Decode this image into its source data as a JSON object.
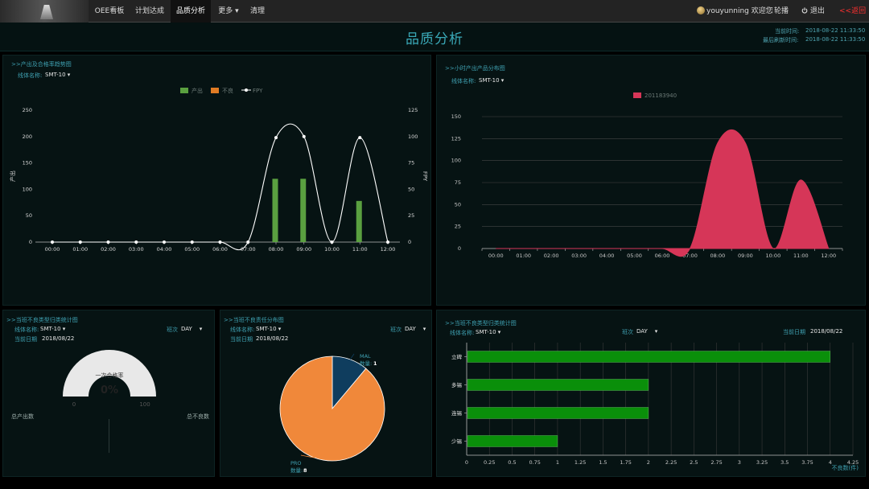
{
  "nav": {
    "tabs": [
      "OEE看板",
      "计划达成",
      "品质分析",
      "更多",
      "清理"
    ],
    "active_tab": "品质分析",
    "more_caret": "▾",
    "user": "youyunning 欢迎您",
    "carousel": "轮播",
    "logout": "退出",
    "back": "<<返回"
  },
  "header": {
    "title": "品质分析",
    "current_time_label": "当前时间:",
    "current_time": "2018-08-22 11:33:50",
    "refresh_time_label": "最后刷新时间:",
    "refresh_time": "2018-08-22 11:33:50"
  },
  "colors": {
    "bar_green": "#5aa040",
    "defect_orange": "#e07b24",
    "pie_orange": "#f0883a",
    "pie_blue": "#0f3d5e",
    "area_red": "#d63658",
    "hbar_green": "#0a8f0a"
  },
  "panel1": {
    "title": ">>产出及合格率趋势图",
    "line_label": "线体名称:",
    "line_value": "SMT-10",
    "caret": "▾",
    "chart_data": {
      "type": "bar+line",
      "categories": [
        "00:00",
        "01:00",
        "02:00",
        "03:00",
        "04:00",
        "05:00",
        "06:00",
        "07:00",
        "08:00",
        "09:00",
        "10:00",
        "11:00",
        "12:00"
      ],
      "series": [
        {
          "name": "产出",
          "type": "bar",
          "axis": "left",
          "values": [
            0,
            0,
            0,
            0,
            0,
            0,
            0,
            0,
            120,
            120,
            0,
            78,
            0
          ]
        },
        {
          "name": "不良",
          "type": "bar",
          "axis": "left",
          "values": [
            0,
            0,
            0,
            0,
            0,
            0,
            0,
            0,
            0,
            0,
            0,
            0,
            0
          ]
        },
        {
          "name": "FPY",
          "type": "line",
          "axis": "right",
          "values": [
            0,
            0,
            0,
            0,
            0,
            0,
            0,
            0,
            99,
            100,
            0,
            99,
            0
          ]
        }
      ],
      "ylabel": "产出",
      "y2label": "FPY",
      "ylim": [
        0,
        250
      ],
      "y2lim": [
        0,
        125
      ],
      "yticks": [
        0,
        50,
        100,
        150,
        200,
        250
      ],
      "y2ticks": [
        0,
        25,
        50,
        75,
        100,
        125
      ],
      "legend": "top-center"
    }
  },
  "panel2": {
    "title": ">>小时产出产品分布图",
    "line_label": "线体名称:",
    "line_value": "SMT-10",
    "caret": "▾",
    "chart_data": {
      "type": "area",
      "categories": [
        "00:00",
        "01:00",
        "02:00",
        "03:00",
        "04:00",
        "05:00",
        "06:00",
        "07:00",
        "08:00",
        "09:00",
        "10:00",
        "11:00",
        "12:00"
      ],
      "series": [
        {
          "name": "201183940",
          "values": [
            0,
            0,
            0,
            0,
            0,
            0,
            0,
            0,
            120,
            120,
            0,
            78,
            0
          ]
        }
      ],
      "ylim": [
        0,
        150
      ],
      "yticks": [
        0,
        25,
        50,
        75,
        100,
        125,
        150
      ],
      "grid": true,
      "legend": "top-center"
    }
  },
  "panel3": {
    "title": ">>当班不良类型归类统计图",
    "line_label": "线体名称:",
    "line_value": "SMT-10",
    "caret": "▾",
    "shift_label": "班次",
    "shift_value": "DAY",
    "date_label": "当前日期",
    "date_value": "2018/08/22",
    "gauge_label": "一次合格率",
    "gauge_value": "0%",
    "gauge_min": "0",
    "gauge_max": "100",
    "gauge_fraction": 0,
    "total_output_label": "总产出数",
    "total_defect_label": "总不良数"
  },
  "panel4": {
    "title": ">>当班不良责任分布图",
    "line_label": "线体名称:",
    "line_value": "SMT-10",
    "caret": "▾",
    "shift_label": "班次",
    "shift_value": "DAY",
    "date_label": "当前日期",
    "date_value": "2018/08/22",
    "chart_data": {
      "type": "pie",
      "slices": [
        {
          "name": "MAL",
          "count_label": "数量:",
          "value": 1
        },
        {
          "name": "PRO",
          "count_label": "数量:",
          "value": 8
        }
      ]
    }
  },
  "panel5": {
    "title": ">>当班不良类型归类统计图",
    "line_label": "线体名称:",
    "line_value": "SMT-10",
    "caret": "▾",
    "shift_label": "班次",
    "shift_value": "DAY",
    "date_label": "当前日期",
    "date_value": "2018/08/22",
    "chart_data": {
      "type": "bar",
      "orientation": "horizontal",
      "categories": [
        "立碑",
        "多锡",
        "连锡",
        "少锡"
      ],
      "values": [
        4,
        2,
        2,
        1
      ],
      "xlim": [
        0,
        4.25
      ],
      "xticks": [
        "0",
        "0.25",
        "0.5",
        "0.75",
        "1",
        "1.25",
        "1.5",
        "1.75",
        "2",
        "2.25",
        "2.5",
        "2.75",
        "3",
        "3.25",
        "3.5",
        "3.75",
        "4",
        "4.25"
      ],
      "xlabel": "不良数(件)"
    }
  }
}
